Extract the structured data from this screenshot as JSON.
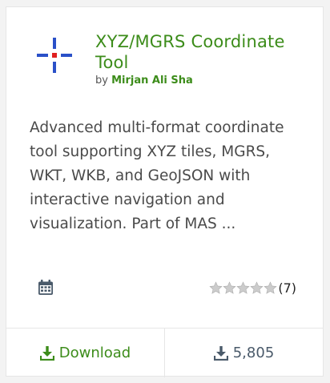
{
  "plugin": {
    "title": "XYZ/MGRS Coordinate Tool",
    "author_prefix": "by",
    "author_name": "Mirjan Ali Sha",
    "description": "Advanced multi-format coordinate tool supporting XYZ tiles, MGRS, WKT, WKB, and GeoJSON with interactive navigation and visualization. Part of MAS ...",
    "rating_count": "(7)",
    "rating_stars": 0,
    "download_label": "Download",
    "download_count": "5,805"
  },
  "icons": {
    "plugin_icon": "crosshair-icon",
    "calendar": "calendar-icon",
    "star": "star-icon",
    "download": "download-icon",
    "download_count": "download-icon"
  },
  "colors": {
    "accent": "#3c8c1a",
    "crosshair_blue": "#2a50c8",
    "crosshair_red": "#e02020",
    "star_empty": "#cccccc",
    "muted": "#4a5a6a"
  }
}
